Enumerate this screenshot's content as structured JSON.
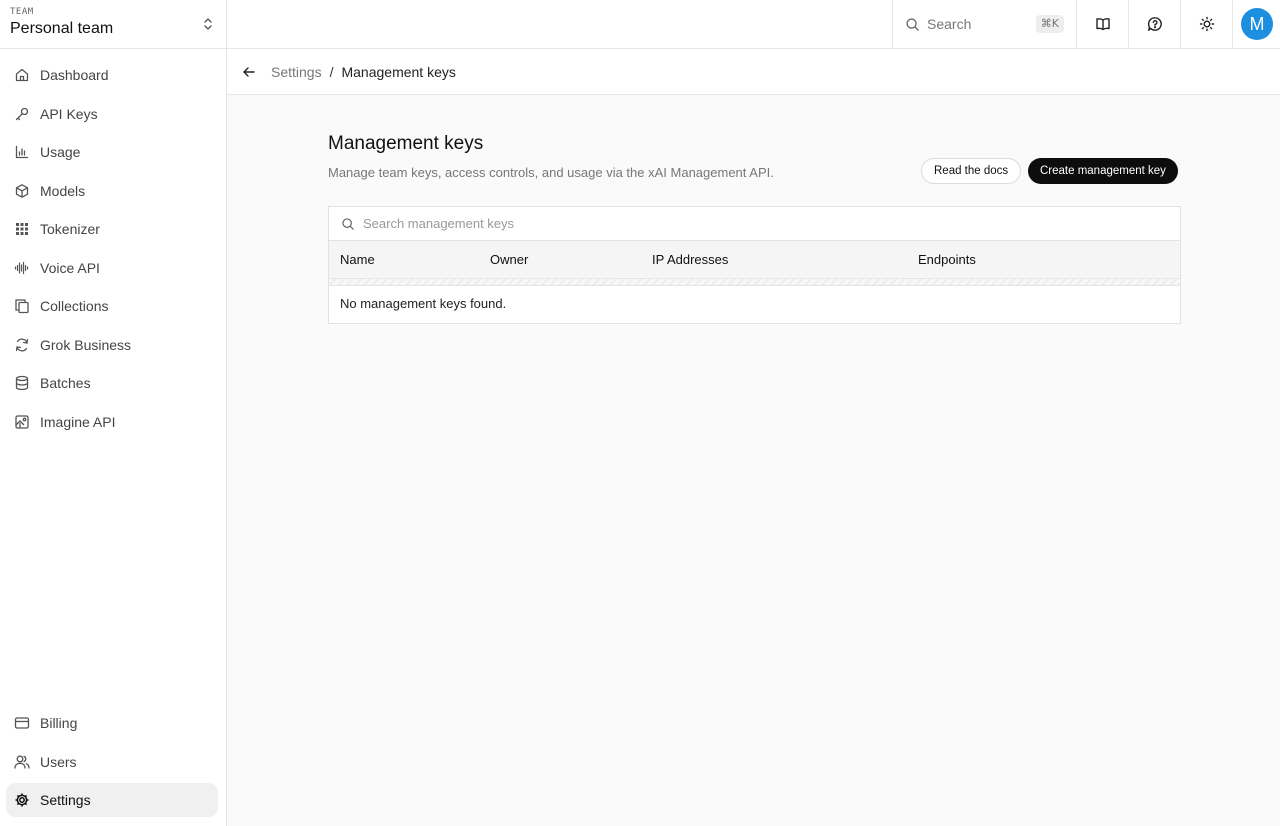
{
  "team": {
    "label": "TEAM",
    "name": "Personal team"
  },
  "sidebar": {
    "items": [
      {
        "label": "Dashboard",
        "icon": "home-icon"
      },
      {
        "label": "API Keys",
        "icon": "key-icon"
      },
      {
        "label": "Usage",
        "icon": "bar-chart-icon"
      },
      {
        "label": "Models",
        "icon": "cube-icon"
      },
      {
        "label": "Tokenizer",
        "icon": "grid-icon"
      },
      {
        "label": "Voice API",
        "icon": "audio-wave-icon"
      },
      {
        "label": "Collections",
        "icon": "copy-icon"
      },
      {
        "label": "Grok Business",
        "icon": "refresh-icon"
      },
      {
        "label": "Batches",
        "icon": "database-icon"
      },
      {
        "label": "Imagine API",
        "icon": "image-icon"
      }
    ],
    "bottom": [
      {
        "label": "Billing",
        "icon": "credit-card-icon"
      },
      {
        "label": "Users",
        "icon": "users-icon"
      },
      {
        "label": "Settings",
        "icon": "gear-icon",
        "active": true
      }
    ]
  },
  "topbar": {
    "search_placeholder": "Search",
    "shortcut": "⌘K",
    "avatar_initial": "M",
    "avatar_color": "#1d8fe0"
  },
  "breadcrumb": {
    "parent": "Settings",
    "separator": "/",
    "current": "Management keys"
  },
  "main": {
    "title": "Management keys",
    "description": "Manage team keys, access controls, and usage via the xAI Management API.",
    "docs_button": "Read the docs",
    "create_button": "Create management key",
    "table": {
      "search_placeholder": "Search management keys",
      "columns": [
        "Name",
        "Owner",
        "IP Addresses",
        "Endpoints"
      ],
      "empty_message": "No management keys found."
    }
  }
}
